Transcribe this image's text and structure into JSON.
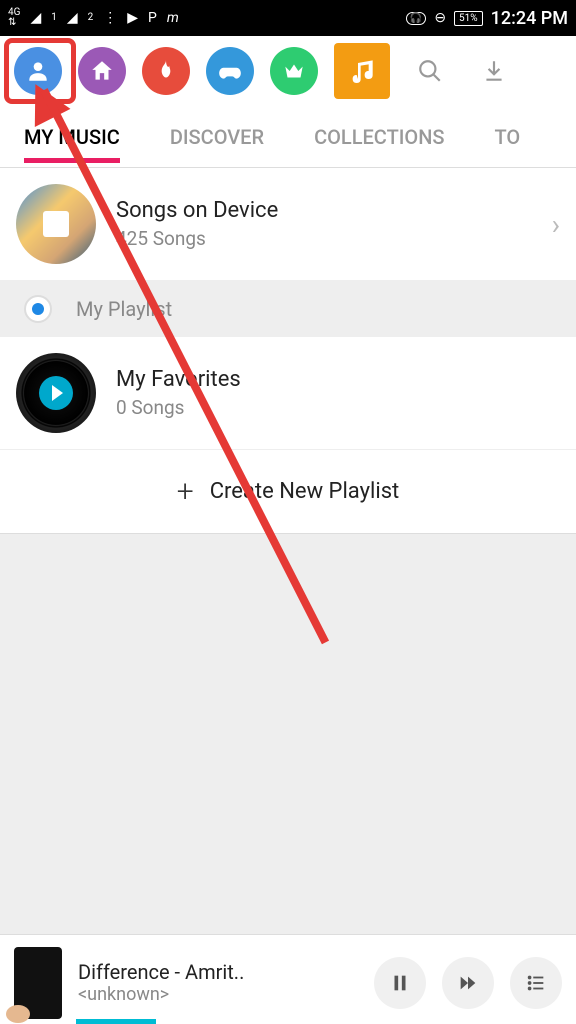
{
  "status": {
    "network": "4G",
    "sim1": "1",
    "sim2": "2",
    "hifi": "HiFi",
    "battery": "51%",
    "time": "12:24 PM"
  },
  "tabs": {
    "my_music": "MY MUSIC",
    "discover": "DISCOVER",
    "collections": "COLLECTIONS",
    "more": "TO"
  },
  "songs_on_device": {
    "title": "Songs on Device",
    "subtitle": "425 Songs"
  },
  "playlist_section": {
    "label": "My Playlist"
  },
  "favorites": {
    "title": "My Favorites",
    "subtitle": "0 Songs"
  },
  "create": {
    "label": "Create New Playlist"
  },
  "now_playing": {
    "title": "Difference - Amrit..",
    "artist": "<unknown>"
  }
}
